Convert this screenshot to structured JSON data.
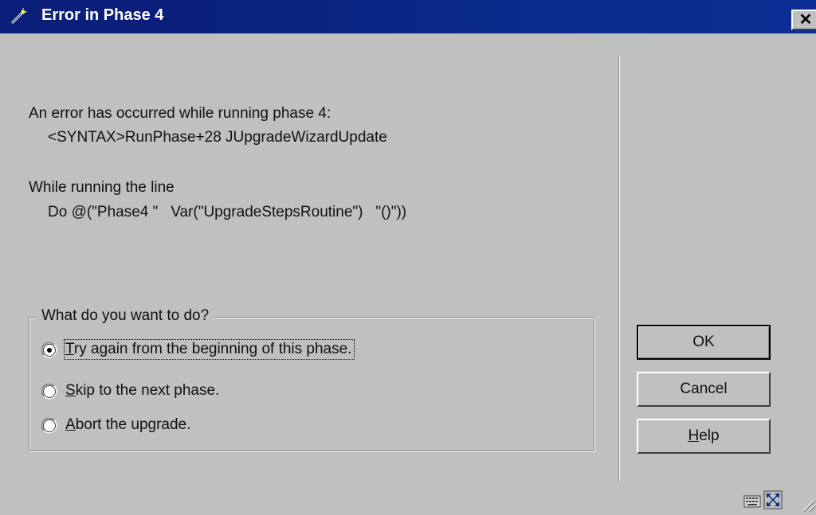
{
  "window": {
    "title": "Error in Phase 4",
    "close_label": "✕",
    "title_icon": "wand-icon"
  },
  "message": {
    "line1": "An error has occurred while running phase 4:",
    "line2": "<SYNTAX>RunPhase+28 JUpgradeWizardUpdate",
    "line3": "While running the line",
    "line4": "Do @(\"Phase4 \"   Var(\"UpgradeStepsRoutine\")   \"()\"))"
  },
  "options": {
    "legend": "What do you want to do?",
    "items": [
      {
        "mnemonic": "T",
        "rest": "ry again from the beginning of this phase.",
        "selected": true
      },
      {
        "mnemonic": "S",
        "rest": "kip to the next phase.",
        "selected": false
      },
      {
        "mnemonic": "A",
        "rest": "bort the upgrade.",
        "selected": false
      }
    ]
  },
  "buttons": {
    "ok": "OK",
    "cancel": "Cancel",
    "help_mnemonic": "H",
    "help_rest": "elp"
  },
  "status": {
    "icons": [
      "keyboard-icon",
      "expand-icon",
      "resize-grip-icon"
    ]
  },
  "colors": {
    "titlebar": "#0a1f7a",
    "face": "#c0c0c0"
  }
}
